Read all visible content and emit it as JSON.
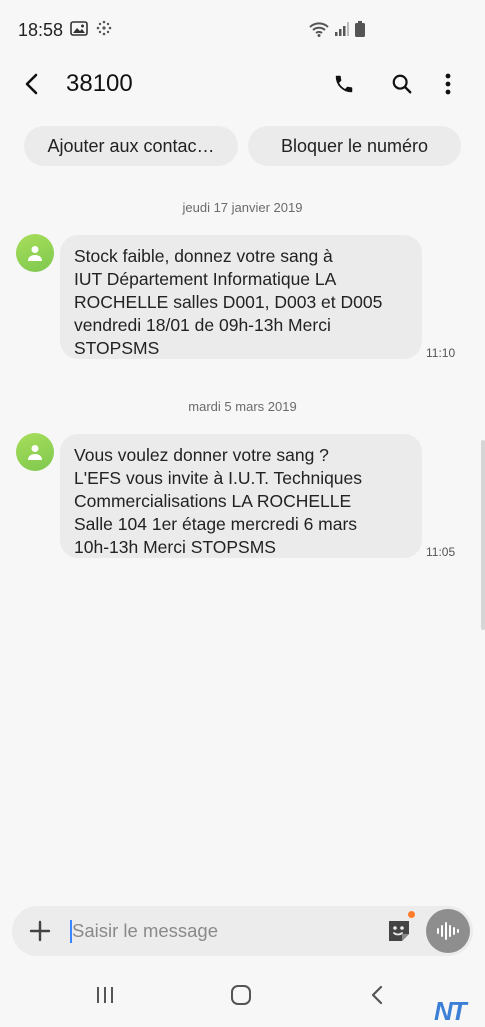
{
  "status_bar": {
    "time": "18:58"
  },
  "app_bar": {
    "title": "38100"
  },
  "chips": {
    "add_contact": "Ajouter aux contac…",
    "block_number": "Bloquer le numéro"
  },
  "messages": [
    {
      "date": "jeudi 17 janvier 2019",
      "lines": [
        "Stock faible, donnez votre sang à",
        "IUT Département Informatique  LA",
        "ROCHELLE salles D001, D003 et D005",
        "vendredi 18/01 de 09h-13h Merci",
        "STOPSMS"
      ],
      "time": "11:10"
    },
    {
      "date": "mardi 5 mars 2019",
      "lines": [
        "Vous voulez donner votre sang ?",
        "L'EFS vous invite à I.U.T. Techniques",
        "Commercialisations LA ROCHELLE",
        "Salle 104 1er étage mercredi  6 mars",
        "10h-13h Merci STOPSMS"
      ],
      "time": "11:05"
    }
  ],
  "composer": {
    "placeholder": "Saisir le message"
  },
  "watermark": {
    "text": "NT"
  },
  "colors": {
    "avatar": "#8fd257",
    "cursor": "#3a84ff",
    "notification_dot": "#ff7b2b",
    "voice_button": "#8e8e8e"
  }
}
